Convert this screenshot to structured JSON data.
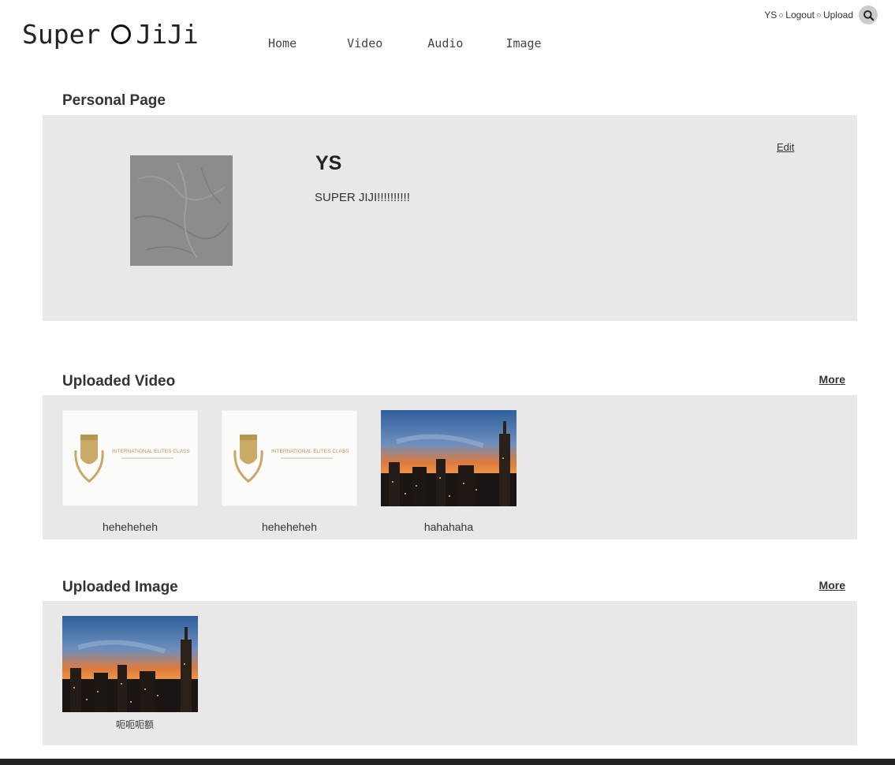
{
  "header": {
    "logo_part1": "Super",
    "logo_part2": "JiJi",
    "nav": [
      "Home",
      "Video",
      "Audio",
      "Image"
    ],
    "user_links": {
      "username": "YS",
      "logout": "Logout",
      "upload": "Upload"
    }
  },
  "personal": {
    "title": "Personal Page",
    "name": "YS",
    "bio": "SUPER JIJI!!!!!!!!!!",
    "edit_label": "Edit"
  },
  "videos": {
    "title": "Uploaded Video",
    "more_label": "More",
    "items": [
      {
        "label": "heheheheh",
        "thumb": "certificate-thumbnail",
        "cert_text": "INTERNATIONAL ELITES CLASS"
      },
      {
        "label": "heheheheh",
        "thumb": "certificate-thumbnail",
        "cert_text": "INTERNATIONAL ELITES CLASS"
      },
      {
        "label": "hahahaha",
        "thumb": "city-sunset-thumbnail"
      }
    ]
  },
  "images": {
    "title": "Uploaded Image",
    "more_label": "More",
    "items": [
      {
        "label": "呃呃呃额",
        "thumb": "city-sunset-thumbnail"
      }
    ]
  },
  "colors": {
    "panel": "#e8e8e8",
    "text": "#333333",
    "search_button": "#cccccc"
  }
}
